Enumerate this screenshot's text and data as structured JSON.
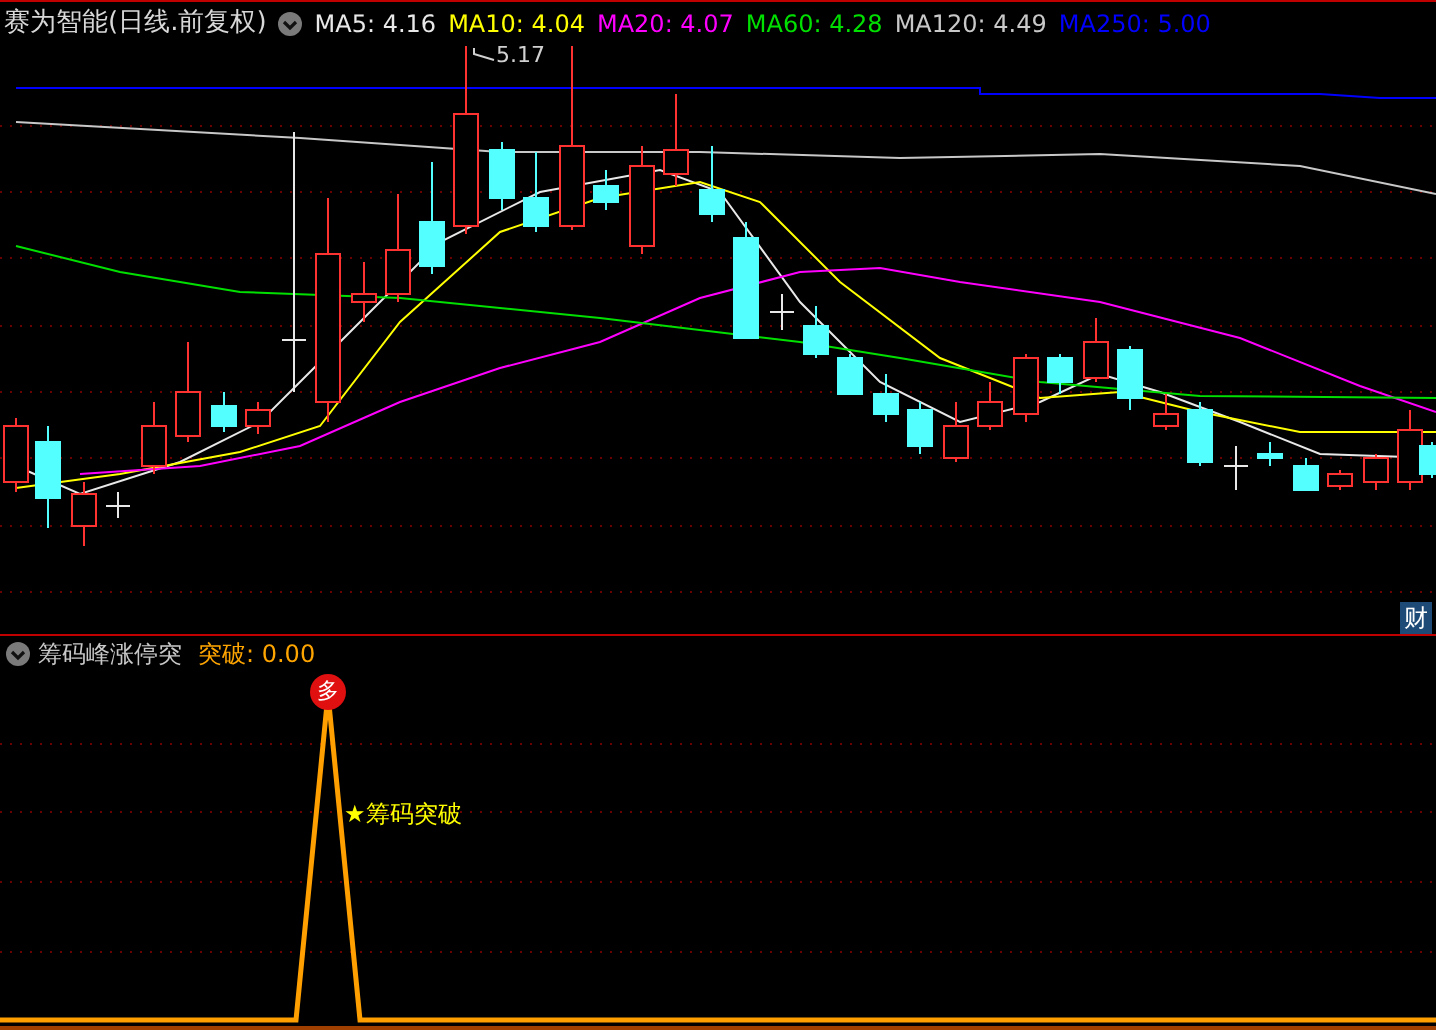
{
  "header": {
    "title": "赛为智能(日线.前复权)",
    "ma": [
      {
        "label": "MA5: 4.16",
        "color": "#e8e8e8"
      },
      {
        "label": "MA10: 4.04",
        "color": "#ffff00"
      },
      {
        "label": "MA20: 4.07",
        "color": "#ff00ff"
      },
      {
        "label": "MA60: 4.28",
        "color": "#00e000"
      },
      {
        "label": "MA120: 4.49",
        "color": "#c8c8c8"
      },
      {
        "label": "MA250: 5.00",
        "color": "#0000ff"
      }
    ]
  },
  "main_chart": {
    "high_label": "5.17",
    "badge": "财"
  },
  "indicator": {
    "name": "筹码峰涨停突",
    "value": "突破: 0.00",
    "signal_badge": "多",
    "signal_label": "★筹码突破"
  }
}
